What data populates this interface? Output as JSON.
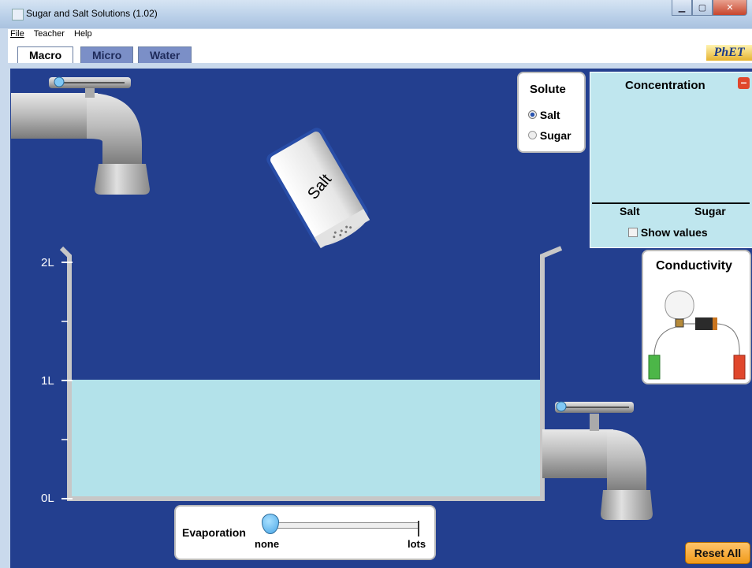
{
  "window": {
    "title": "Sugar and Salt Solutions (1.02)"
  },
  "menu": {
    "file": "File",
    "teacher": "Teacher",
    "help": "Help"
  },
  "tabs": [
    {
      "label": "Macro"
    },
    {
      "label": "Micro"
    },
    {
      "label": "Water"
    }
  ],
  "logo": {
    "text": "PhET"
  },
  "solute": {
    "title": "Solute",
    "options": [
      {
        "label": "Salt",
        "selected": true
      },
      {
        "label": "Sugar",
        "selected": false
      }
    ]
  },
  "shaker": {
    "label": "Salt"
  },
  "concentration": {
    "title": "Concentration",
    "bar_labels": [
      "Salt",
      "Sugar"
    ],
    "show_values_label": "Show values",
    "show_values_checked": false
  },
  "conductivity": {
    "title": "Conductivity"
  },
  "beaker": {
    "ticks": [
      "2L",
      "1L",
      "0L"
    ],
    "water_level_liters": 1.0,
    "max_liters": 2.0
  },
  "evaporation": {
    "label": "Evaporation",
    "min_label": "none",
    "max_label": "lots",
    "value": 0
  },
  "faucets": {
    "top_flow": 0,
    "drain_flow": 0
  },
  "reset_all": {
    "label": "Reset All"
  },
  "colors": {
    "background": "#233f8f",
    "water": "#b3e2ea",
    "concentration_bg": "#bfe6ee",
    "reset_button": "#f7a832"
  }
}
